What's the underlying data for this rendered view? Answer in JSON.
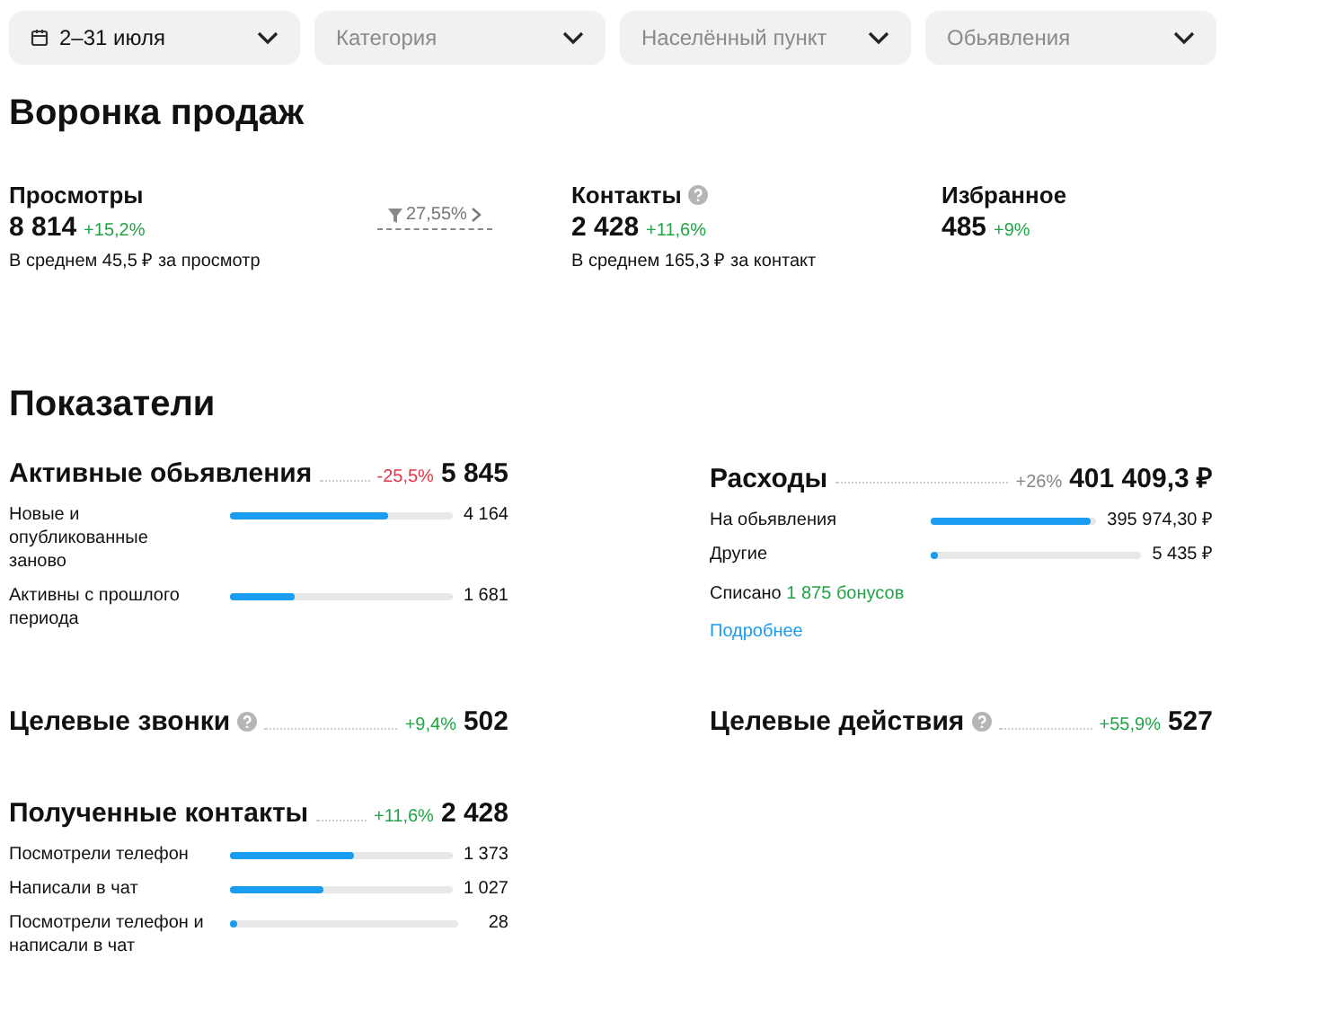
{
  "filters": [
    {
      "kind": "date",
      "value": "2–31 июля"
    },
    {
      "kind": "select",
      "placeholder": "Категория"
    },
    {
      "kind": "select",
      "placeholder": "Населённый пункт"
    },
    {
      "kind": "select",
      "placeholder": "Обьявления"
    }
  ],
  "funnel": {
    "title": "Воронка продаж",
    "metrics": [
      {
        "name": "Просмотры",
        "help": false,
        "value": "8 814",
        "change": "+15,2%",
        "color": "#22a447",
        "note": "В среднем 45,5 ₽ за просмотр"
      },
      {
        "kind": "conversion",
        "value": "27,55%"
      },
      {
        "name": "Контакты",
        "help": true,
        "value": "2 428",
        "change": "+11,6%",
        "color": "#22a447",
        "note": "В среднем 165,3 ₽ за контакт"
      },
      {
        "name": "Избранное",
        "help": false,
        "value": "485",
        "change": "+9%",
        "color": "#22a447"
      }
    ]
  },
  "indicators": {
    "title": "Показатели",
    "blocks": [
      {
        "title": "Активные обьявления",
        "help": false,
        "change": "-25,5%",
        "color": "#e0384a",
        "value": "5 845",
        "rows": [
          {
            "label": "Новые и опубликованные заново",
            "level": 0.71,
            "value": "4 164"
          },
          {
            "label": "Активны с прошлого периода",
            "level": 0.29,
            "value": "1 681"
          }
        ]
      },
      {
        "title": "Расходы",
        "help": false,
        "change": "+26%",
        "color": "#888888",
        "value": "401 409,3 ₽",
        "rows": [
          {
            "label": "На обьявления",
            "level": 0.97,
            "value": "395 974,30 ₽"
          },
          {
            "label": "Другие",
            "level": 0.03,
            "value": "5 435 ₽"
          }
        ],
        "written_off": {
          "label": "Списано",
          "amount": "1 875 бонусов"
        },
        "link": "Подробнее"
      },
      {
        "title": "Целевые звонки",
        "help": true,
        "change": "+9,4%",
        "color": "#22a447",
        "value": "502"
      },
      {
        "title": "Целевые действия",
        "help": true,
        "change": "+55,9%",
        "color": "#22a447",
        "value": "527"
      },
      {
        "title": "Полученные контакты",
        "help": false,
        "change": "+11,6%",
        "color": "#22a447",
        "value": "2 428",
        "rows": [
          {
            "label": "Посмотрели телефон",
            "level": 0.56,
            "value": "1 373"
          },
          {
            "label": "Написали в чат",
            "level": 0.42,
            "value": "1 027"
          },
          {
            "label": "Посмотрели телефон и написали в чат",
            "level": 0.03,
            "value": "28"
          }
        ]
      }
    ]
  }
}
